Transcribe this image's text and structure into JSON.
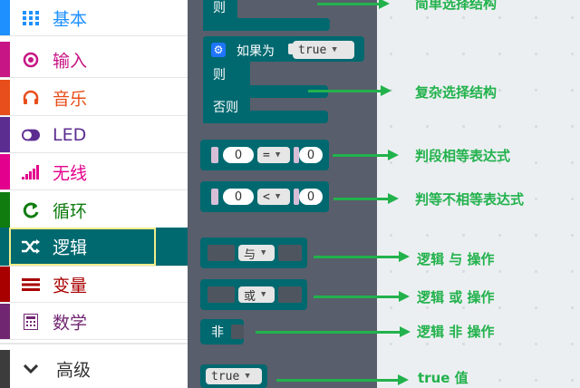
{
  "sidebar": {
    "categories": [
      {
        "label": "基本",
        "color": "#1e90ff",
        "icon": "grid-icon"
      },
      {
        "label": "输入",
        "color": "#c71585",
        "icon": "target-icon"
      },
      {
        "label": "音乐",
        "color": "#e84e1b",
        "icon": "headphones-icon"
      },
      {
        "label": "LED",
        "color": "#5c2d91",
        "icon": "toggle-icon"
      },
      {
        "label": "无线",
        "color": "#e3008c",
        "icon": "signal-bars-icon"
      },
      {
        "label": "循环",
        "color": "#107c10",
        "icon": "refresh-icon"
      },
      {
        "label": "逻辑",
        "color": "#006970",
        "icon": "shuffle-icon",
        "selected": true
      },
      {
        "label": "变量",
        "color": "#a80000",
        "icon": "lines-icon"
      },
      {
        "label": "数学",
        "color": "#712672",
        "icon": "calculator-icon"
      }
    ],
    "advanced": {
      "label": "高级",
      "icon": "chevron-down-icon",
      "color": "#3c3c3c"
    }
  },
  "palette": {
    "simple_if_else": {
      "else_label": "则"
    },
    "complex_if": {
      "if_label": "如果为",
      "condition": "true",
      "then_label": "则",
      "else_label": "否则"
    },
    "compare_eq": {
      "left": "0",
      "op": "=",
      "right": "0"
    },
    "compare_lt": {
      "left": "0",
      "op": "<",
      "right": "0"
    },
    "and_block": {
      "op": "与"
    },
    "or_block": {
      "op": "或"
    },
    "not_block": {
      "label": "非"
    },
    "bool_block": {
      "value": "true"
    }
  },
  "annotations": [
    "简单选择结构",
    "复杂选择结构",
    "判段相等表达式",
    "判等不相等表达式",
    "逻辑 与 操作",
    "逻辑 或 操作",
    "逻辑 非 操作",
    "true 值"
  ],
  "colors": {
    "logic": "#006970",
    "palette_bg": "#585e6b",
    "annotation": "#22b24c"
  }
}
